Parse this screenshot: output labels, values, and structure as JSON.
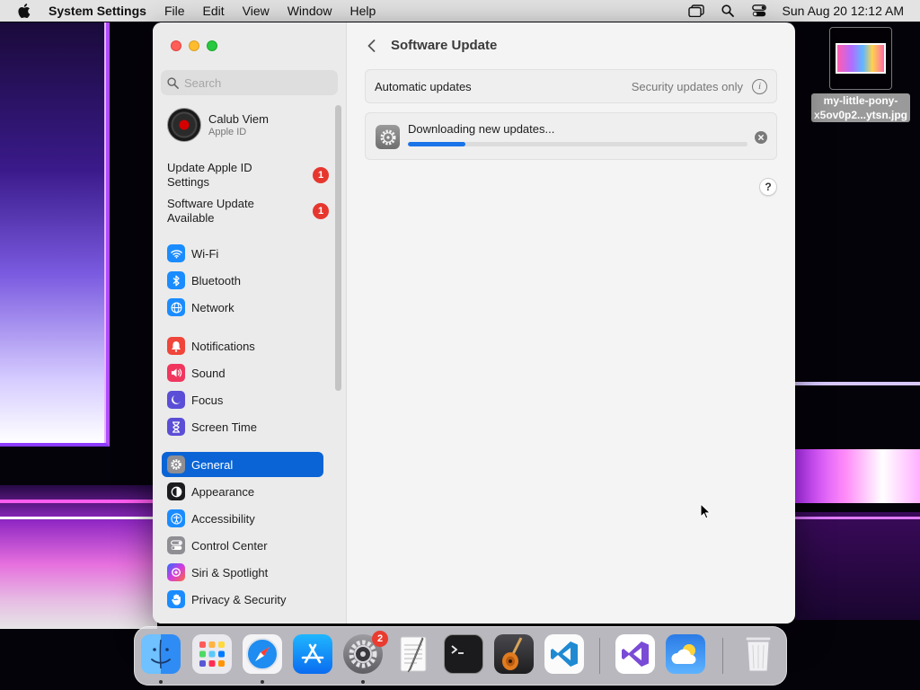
{
  "menubar": {
    "app_name": "System Settings",
    "items": [
      "File",
      "Edit",
      "View",
      "Window",
      "Help"
    ],
    "clock": "Sun Aug 20  12:12 AM"
  },
  "desktop": {
    "file_label_line1": "my-little-pony-",
    "file_label_line2": "x5ov0p2...ytsn.jpg"
  },
  "sidebar": {
    "search_placeholder": "Search",
    "account": {
      "name": "Calub Viem",
      "subtitle": "Apple ID"
    },
    "notices": [
      {
        "label": "Update Apple ID Settings",
        "badge": "1"
      },
      {
        "label": "Software Update Available",
        "badge": "1"
      }
    ],
    "items": [
      {
        "label": "Wi-Fi",
        "icon": "wifi-icon",
        "color": "#1a8cff"
      },
      {
        "label": "Bluetooth",
        "icon": "bluetooth-icon",
        "color": "#1a8cff"
      },
      {
        "label": "Network",
        "icon": "globe-icon",
        "color": "#1a8cff"
      },
      {
        "label": "Notifications",
        "icon": "bell-icon",
        "color": "#f0453a"
      },
      {
        "label": "Sound",
        "icon": "speaker-icon",
        "color": "#f0365e"
      },
      {
        "label": "Focus",
        "icon": "moon-icon",
        "color": "#5b4ed6"
      },
      {
        "label": "Screen Time",
        "icon": "hourglass-icon",
        "color": "#5b4ed6"
      },
      {
        "label": "General",
        "icon": "gear-icon",
        "color": "#8e8e93"
      },
      {
        "label": "Appearance",
        "icon": "appearance-icon",
        "color": "#1c1c1e"
      },
      {
        "label": "Accessibility",
        "icon": "accessibility-icon",
        "color": "#1a8cff"
      },
      {
        "label": "Control Center",
        "icon": "control-center-icon",
        "color": "#8e8e93"
      },
      {
        "label": "Siri & Spotlight",
        "icon": "siri-icon",
        "color": "#b03cd8"
      },
      {
        "label": "Privacy & Security",
        "icon": "hand-icon",
        "color": "#1a8cff"
      }
    ],
    "selected": "General"
  },
  "main": {
    "title": "Software Update",
    "automatic_updates": {
      "label": "Automatic updates",
      "value": "Security updates only"
    },
    "download": {
      "status": "Downloading new updates...",
      "progress": 0.17
    },
    "help": "?"
  },
  "dock": {
    "apps": [
      "Finder",
      "Launchpad",
      "Safari",
      "App Store",
      "System Settings",
      "TextEdit",
      "Terminal",
      "GarageBand",
      "Visual Studio Code",
      "Visual Studio",
      "Weather",
      "Trash"
    ],
    "system_settings_badge": "2"
  },
  "colors": {
    "accent": "#0a64d6",
    "badge": "#e6372f",
    "progress": "#1a73e8"
  }
}
